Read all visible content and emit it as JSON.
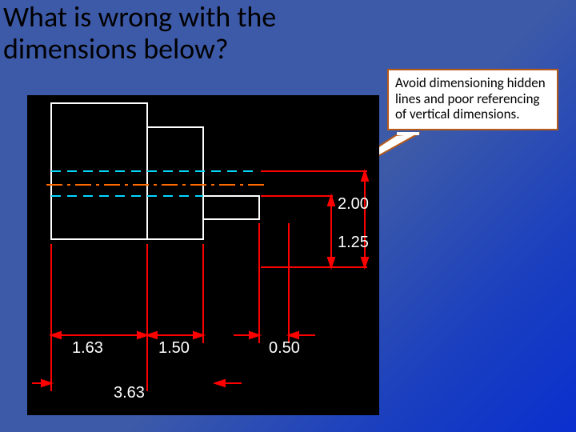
{
  "title": "What is wrong with the dimensions below?",
  "callout": "Avoid dimensioning hidden lines and poor referencing of vertical dimensions.",
  "chart_data": {
    "type": "diagram",
    "title": "Engineering drawing with dimensions",
    "dimensions": {
      "horizontal": [
        {
          "label": "1.63",
          "value": 1.63
        },
        {
          "label": "1.50",
          "value": 1.5
        },
        {
          "label": "0.50",
          "value": 0.5
        },
        {
          "label": "3.63",
          "value": 3.63
        }
      ],
      "vertical": [
        {
          "label": "2.00",
          "value": 2.0
        },
        {
          "label": "1.25",
          "value": 1.25
        }
      ]
    }
  }
}
